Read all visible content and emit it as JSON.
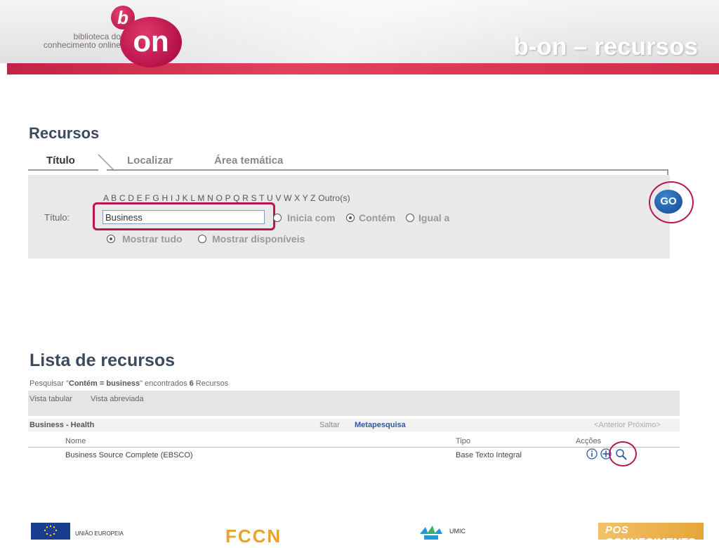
{
  "header": {
    "logo_tagline_line1": "biblioteca do",
    "logo_tagline_line2": "conhecimento online",
    "logo_b": "b",
    "logo_on": "on",
    "title": "b-on – recursos"
  },
  "recursos": {
    "title": "Recursos",
    "tabs": [
      "Título",
      "Localizar",
      "Área temática"
    ],
    "alphabet": "A B C D E F G H I J K L M N O P Q R S T U V W X Y Z Outro(s)",
    "field_label": "Título:",
    "field_value": "Business",
    "match_options": [
      "Inicia com",
      "Contém",
      "Igual a"
    ],
    "match_selected": "Contém",
    "display_options": [
      "Mostrar tudo",
      "Mostrar disponíveis"
    ],
    "display_selected": "Mostrar tudo",
    "go_label": "GO"
  },
  "lista": {
    "title": "Lista de recursos",
    "summary_prefix": "Pesquisar \"",
    "summary_query": "Contém = business",
    "summary_mid": "\" encontrados ",
    "summary_count": "6",
    "summary_suffix": " Recursos",
    "view_tabular": "Vista tabular",
    "view_abreviada": "Vista abreviada",
    "group": "Business - Health",
    "saltar": "Saltar",
    "metapesquisa": "Metapesquisa",
    "pager": "<Anterior Próximo>",
    "columns": [
      "Nome",
      "Tipo",
      "Acções"
    ],
    "rows": [
      {
        "nome": "Business Source Complete (EBSCO)",
        "tipo": "Base Texto Integral"
      }
    ]
  },
  "footer": {
    "eu_label": "UNIÃO EUROPEIA",
    "fccn": "FCCN",
    "umic": "UMIC",
    "pos_label": "POS CONHECIMENTO"
  },
  "colors": {
    "brand_magenta": "#b81654",
    "go_blue": "#1d5aa3",
    "link_blue": "#335a9e"
  }
}
